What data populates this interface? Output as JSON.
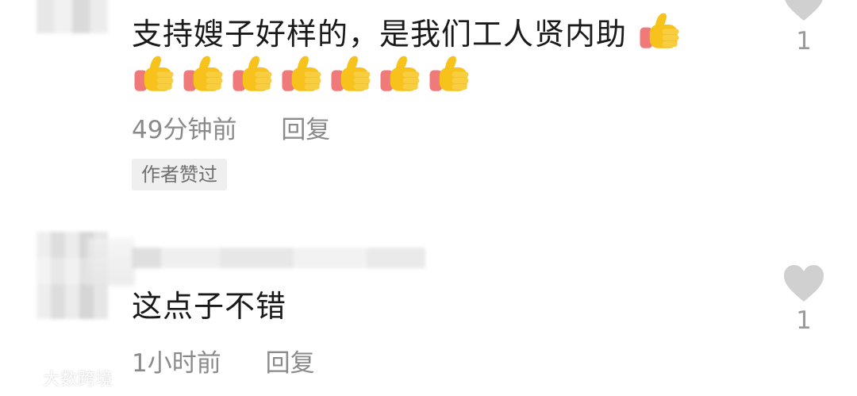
{
  "colors": {
    "text": "#1a1a1a",
    "meta": "#8a8a8a",
    "badge_bg": "#efefef",
    "heart": "#d0d0d0",
    "thumb_yellow": "#f6c21b",
    "thumb_sleeve": "#f07a7a"
  },
  "comments": [
    {
      "text": "支持嫂子好样的，是我们工人贤内助",
      "trailing_emoji": "thumbs-up-icon",
      "emoji_row_count": 7,
      "time": "49分钟前",
      "reply_label": "回复",
      "author_badge": "作者赞过",
      "like_count": "1"
    },
    {
      "text": "这点子不错",
      "time": "1小时前",
      "reply_label": "回复",
      "like_count": "1"
    }
  ],
  "watermark": {
    "text": "大数跨境"
  }
}
